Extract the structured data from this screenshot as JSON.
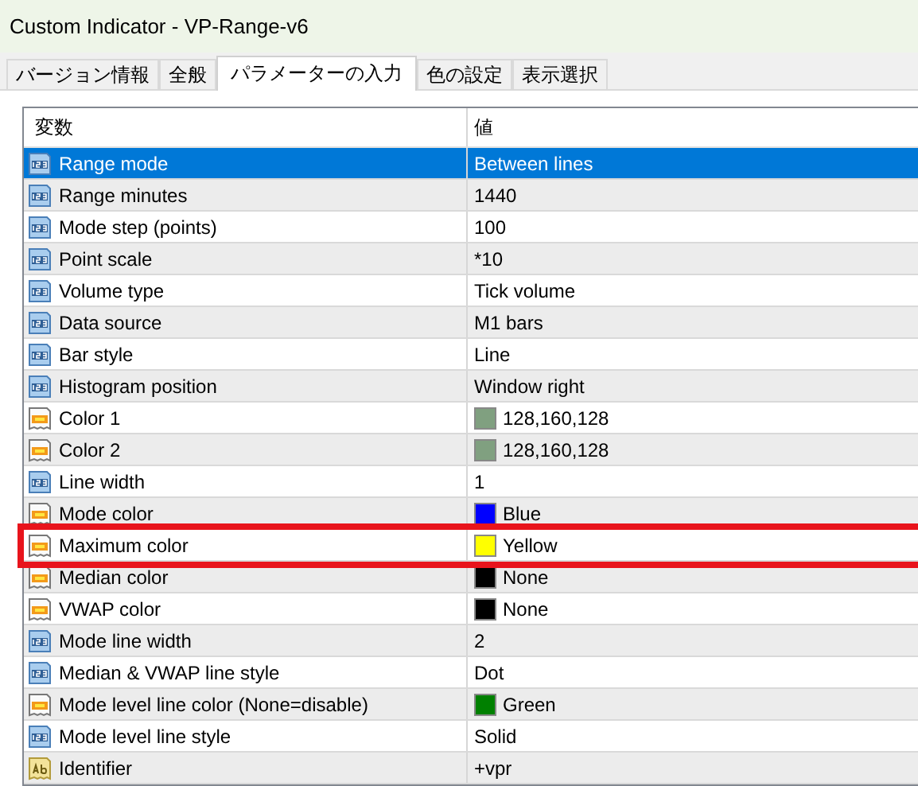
{
  "window": {
    "title": "Custom Indicator - VP-Range-v6"
  },
  "tabs": [
    {
      "label": "バージョン情報",
      "selected": false
    },
    {
      "label": "全般",
      "selected": false
    },
    {
      "label": "パラメーターの入力",
      "selected": true
    },
    {
      "label": "色の設定",
      "selected": false
    },
    {
      "label": "表示選択",
      "selected": false
    }
  ],
  "table": {
    "columns": [
      "変数",
      "値"
    ],
    "rows": [
      {
        "kind": "number",
        "name": "Range mode",
        "value": "Between lines",
        "selected": true,
        "highlighted": false
      },
      {
        "kind": "number",
        "name": "Range minutes",
        "value": "1440",
        "selected": false,
        "highlighted": false
      },
      {
        "kind": "number",
        "name": "Mode step (points)",
        "value": "100",
        "selected": false,
        "highlighted": false
      },
      {
        "kind": "number",
        "name": "Point scale",
        "value": "*10",
        "selected": false,
        "highlighted": false
      },
      {
        "kind": "number",
        "name": "Volume type",
        "value": "Tick volume",
        "selected": false,
        "highlighted": false
      },
      {
        "kind": "number",
        "name": "Data source",
        "value": "M1 bars",
        "selected": false,
        "highlighted": false
      },
      {
        "kind": "number",
        "name": "Bar style",
        "value": "Line",
        "selected": false,
        "highlighted": false
      },
      {
        "kind": "number",
        "name": "Histogram position",
        "value": "Window right",
        "selected": false,
        "highlighted": false
      },
      {
        "kind": "color",
        "name": "Color 1",
        "value": "128,160,128",
        "color": "#80a080",
        "selected": false,
        "highlighted": false
      },
      {
        "kind": "color",
        "name": "Color 2",
        "value": "128,160,128",
        "color": "#80a080",
        "selected": false,
        "highlighted": false
      },
      {
        "kind": "number",
        "name": "Line width",
        "value": "1",
        "selected": false,
        "highlighted": false
      },
      {
        "kind": "color",
        "name": "Mode color",
        "value": "Blue",
        "color": "#0000ff",
        "selected": false,
        "highlighted": false
      },
      {
        "kind": "color",
        "name": "Maximum color",
        "value": "Yellow",
        "color": "#ffff00",
        "selected": false,
        "highlighted": true
      },
      {
        "kind": "color",
        "name": "Median color",
        "value": "None",
        "color": "#000000",
        "selected": false,
        "highlighted": false
      },
      {
        "kind": "color",
        "name": "VWAP color",
        "value": "None",
        "color": "#000000",
        "selected": false,
        "highlighted": false
      },
      {
        "kind": "number",
        "name": "Mode line width",
        "value": "2",
        "selected": false,
        "highlighted": false
      },
      {
        "kind": "number",
        "name": "Median & VWAP line style",
        "value": "Dot",
        "selected": false,
        "highlighted": false
      },
      {
        "kind": "color",
        "name": "Mode level line color (None=disable)",
        "value": "Green",
        "color": "#008000",
        "selected": false,
        "highlighted": false
      },
      {
        "kind": "number",
        "name": "Mode level line style",
        "value": "Solid",
        "selected": false,
        "highlighted": false
      },
      {
        "kind": "string",
        "name": "Identifier",
        "value": "+vpr",
        "selected": false,
        "highlighted": false
      }
    ]
  }
}
